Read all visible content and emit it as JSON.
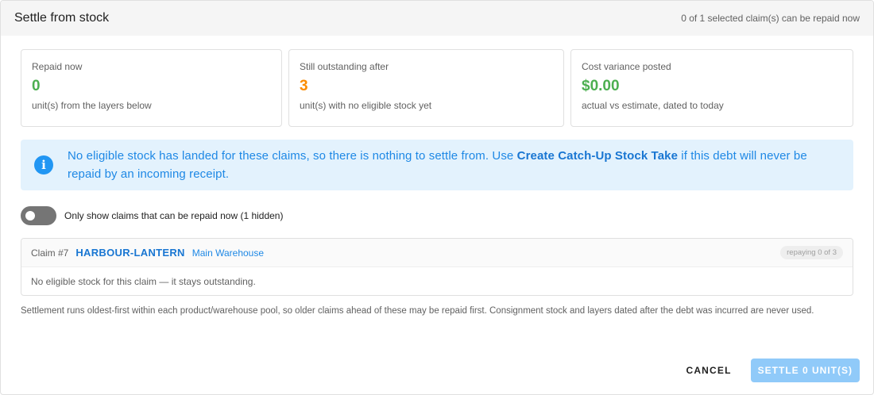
{
  "header": {
    "title": "Settle from stock",
    "status": "0 of 1 selected claim(s) can be repaid now"
  },
  "stats": [
    {
      "label": "Repaid now",
      "value": "0",
      "sub": "unit(s) from the layers below",
      "color": "#4caf50"
    },
    {
      "label": "Still outstanding after",
      "value": "3",
      "sub": "unit(s) with no eligible stock yet",
      "color": "#fb8c00"
    },
    {
      "label": "Cost variance posted",
      "value": "$0.00",
      "sub": "actual vs estimate, dated to today",
      "color": "#4caf50"
    }
  ],
  "alert": {
    "icon": "info-icon",
    "text_before": "No eligible stock has landed for these claims, so there is nothing to settle from. Use ",
    "link": "Create Catch-Up Stock Take",
    "text_after": " if this debt will never be repaid by an incoming receipt."
  },
  "filter_toggle": {
    "label": "Only show claims that can be repaid now (1 hidden)",
    "on": false
  },
  "claims": [
    {
      "number": "Claim #7",
      "product": "HARBOUR-LANTERN",
      "warehouse": "Main Warehouse",
      "badge": "repaying 0 of 3",
      "message": "No eligible stock for this claim — it stays outstanding."
    }
  ],
  "footnote": "Settlement runs oldest-first within each product/warehouse pool, so older claims ahead of these may be repaid first. Consignment stock and layers dated after the debt was incurred are never used.",
  "actions": {
    "cancel": "CANCEL",
    "settle": "SETTLE 0 UNIT(S)"
  },
  "colors": {
    "accent": "#1976d2",
    "alert_bg": "#e3f2fd",
    "settle_disabled": "#90caf9"
  }
}
